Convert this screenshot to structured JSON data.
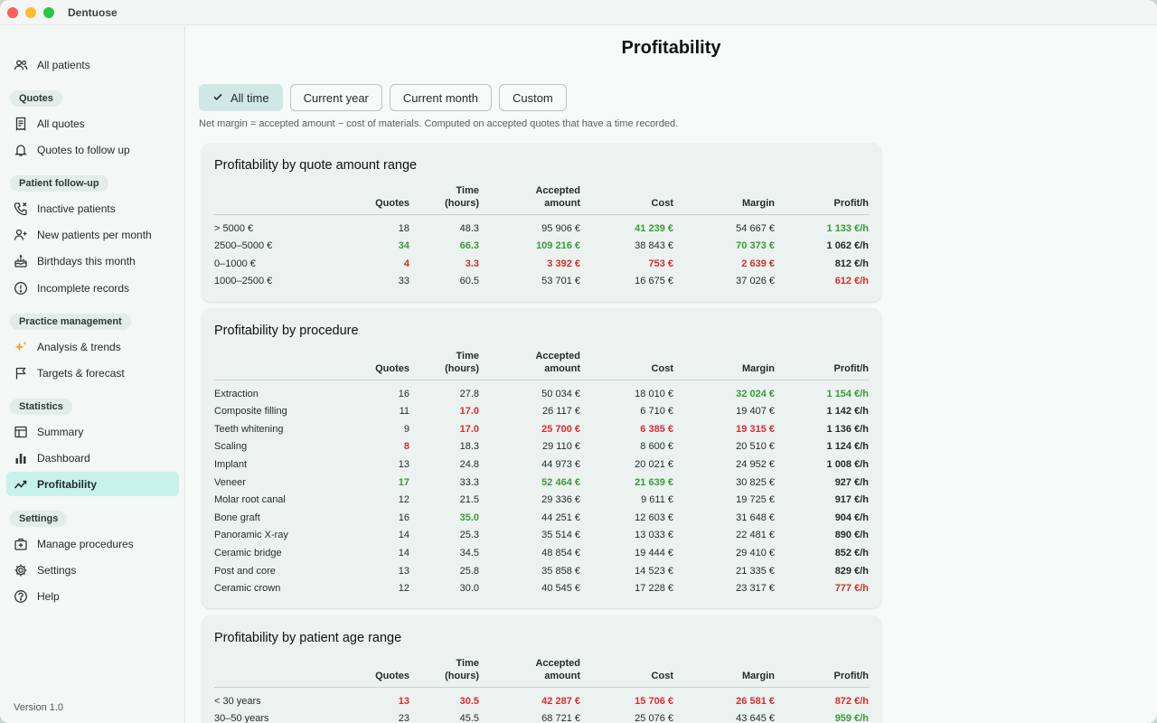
{
  "app": {
    "title": "Dentuose",
    "version": "Version 1.0"
  },
  "sidebar": {
    "top_item": {
      "label": "All patients",
      "icon": "users-icon"
    },
    "sections": [
      {
        "title": "Quotes",
        "items": [
          {
            "label": "All quotes",
            "icon": "receipt-icon"
          },
          {
            "label": "Quotes to follow up",
            "icon": "bell-icon"
          }
        ]
      },
      {
        "title": "Patient follow-up",
        "items": [
          {
            "label": "Inactive patients",
            "icon": "phone-icon"
          },
          {
            "label": "New patients per month",
            "icon": "user-plus-icon"
          },
          {
            "label": "Birthdays this month",
            "icon": "cake-icon"
          },
          {
            "label": "Incomplete records",
            "icon": "alert-circle-icon"
          }
        ]
      },
      {
        "title": "Practice management",
        "items": [
          {
            "label": "Analysis & trends",
            "icon": "sparkles-icon"
          },
          {
            "label": "Targets & forecast",
            "icon": "flag-icon"
          }
        ]
      },
      {
        "title": "Statistics",
        "items": [
          {
            "label": "Summary",
            "icon": "table-icon"
          },
          {
            "label": "Dashboard",
            "icon": "bar-chart-icon"
          },
          {
            "label": "Profitability",
            "icon": "trend-icon",
            "active": true
          }
        ]
      },
      {
        "title": "Settings",
        "items": [
          {
            "label": "Manage procedures",
            "icon": "medical-case-icon"
          },
          {
            "label": "Settings",
            "icon": "gear-icon"
          },
          {
            "label": "Help",
            "icon": "help-icon"
          }
        ]
      }
    ]
  },
  "main": {
    "title": "Profitability",
    "filters": [
      {
        "label": "All time",
        "selected": true
      },
      {
        "label": "Current year",
        "selected": false
      },
      {
        "label": "Current month",
        "selected": false
      },
      {
        "label": "Custom",
        "selected": false
      }
    ],
    "note": "Net margin = accepted amount − cost of materials. Computed on accepted quotes that have a time recorded.",
    "columns": [
      "",
      "Quotes",
      "Time\n(hours)",
      "Accepted\namount",
      "Cost",
      "Margin",
      "Profit/h"
    ],
    "tables": [
      {
        "title": "Profitability by quote amount range",
        "rows": [
          {
            "cells": [
              "> 5000 €",
              "18",
              "48.3",
              "95 906 €",
              "41 239 €",
              "54 667 €",
              "1 133 €/h"
            ],
            "hl": [
              "",
              "",
              "",
              "",
              "g",
              "",
              "g"
            ]
          },
          {
            "cells": [
              "2500–5000 €",
              "34",
              "66.3",
              "109 216 €",
              "38 843 €",
              "70 373 €",
              "1 062 €/h"
            ],
            "hl": [
              "",
              "g",
              "g",
              "g",
              "",
              "g",
              ""
            ]
          },
          {
            "cells": [
              "0–1000 €",
              "4",
              "3.3",
              "3 392 €",
              "753 €",
              "2 639 €",
              "812 €/h"
            ],
            "hl": [
              "",
              "r",
              "r",
              "r",
              "r",
              "r",
              ""
            ]
          },
          {
            "cells": [
              "1000–2500 €",
              "33",
              "60.5",
              "53 701 €",
              "16 675 €",
              "37 026 €",
              "612 €/h"
            ],
            "hl": [
              "",
              "",
              "",
              "",
              "",
              "",
              "r"
            ]
          }
        ]
      },
      {
        "title": "Profitability by procedure",
        "rows": [
          {
            "cells": [
              "Extraction",
              "16",
              "27.8",
              "50 034 €",
              "18 010 €",
              "32 024 €",
              "1 154 €/h"
            ],
            "hl": [
              "",
              "",
              "",
              "",
              "",
              "g",
              "g"
            ]
          },
          {
            "cells": [
              "Composite filling",
              "11",
              "17.0",
              "26 117 €",
              "6 710 €",
              "19 407 €",
              "1 142 €/h"
            ],
            "hl": [
              "",
              "",
              "r",
              "",
              "",
              "",
              ""
            ]
          },
          {
            "cells": [
              "Teeth whitening",
              "9",
              "17.0",
              "25 700 €",
              "6 385 €",
              "19 315 €",
              "1 136 €/h"
            ],
            "hl": [
              "",
              "",
              "r",
              "r",
              "r",
              "r",
              ""
            ]
          },
          {
            "cells": [
              "Scaling",
              "8",
              "18.3",
              "29 110 €",
              "8 600 €",
              "20 510 €",
              "1 124 €/h"
            ],
            "hl": [
              "",
              "r",
              "",
              "",
              "",
              "",
              ""
            ]
          },
          {
            "cells": [
              "Implant",
              "13",
              "24.8",
              "44 973 €",
              "20 021 €",
              "24 952 €",
              "1 008 €/h"
            ],
            "hl": [
              "",
              "",
              "",
              "",
              "",
              "",
              ""
            ]
          },
          {
            "cells": [
              "Veneer",
              "17",
              "33.3",
              "52 464 €",
              "21 639 €",
              "30 825 €",
              "927 €/h"
            ],
            "hl": [
              "",
              "g",
              "",
              "g",
              "g",
              "",
              ""
            ]
          },
          {
            "cells": [
              "Molar root canal",
              "12",
              "21.5",
              "29 336 €",
              "9 611 €",
              "19 725 €",
              "917 €/h"
            ],
            "hl": [
              "",
              "",
              "",
              "",
              "",
              "",
              ""
            ]
          },
          {
            "cells": [
              "Bone graft",
              "16",
              "35.0",
              "44 251 €",
              "12 603 €",
              "31 648 €",
              "904 €/h"
            ],
            "hl": [
              "",
              "",
              "g",
              "",
              "",
              "",
              ""
            ]
          },
          {
            "cells": [
              "Panoramic X-ray",
              "14",
              "25.3",
              "35 514 €",
              "13 033 €",
              "22 481 €",
              "890 €/h"
            ],
            "hl": [
              "",
              "",
              "",
              "",
              "",
              "",
              ""
            ]
          },
          {
            "cells": [
              "Ceramic bridge",
              "14",
              "34.5",
              "48 854 €",
              "19 444 €",
              "29 410 €",
              "852 €/h"
            ],
            "hl": [
              "",
              "",
              "",
              "",
              "",
              "",
              ""
            ]
          },
          {
            "cells": [
              "Post and core",
              "13",
              "25.8",
              "35 858 €",
              "14 523 €",
              "21 335 €",
              "829 €/h"
            ],
            "hl": [
              "",
              "",
              "",
              "",
              "",
              "",
              ""
            ]
          },
          {
            "cells": [
              "Ceramic crown",
              "12",
              "30.0",
              "40 545 €",
              "17 228 €",
              "23 317 €",
              "777 €/h"
            ],
            "hl": [
              "",
              "",
              "",
              "",
              "",
              "",
              "r"
            ]
          }
        ]
      },
      {
        "title": "Profitability by patient age range",
        "rows": [
          {
            "cells": [
              "< 30 years",
              "13",
              "30.5",
              "42 287 €",
              "15 706 €",
              "26 581 €",
              "872 €/h"
            ],
            "hl": [
              "",
              "r",
              "r",
              "r",
              "r",
              "r",
              "r"
            ]
          },
          {
            "cells": [
              "30–50 years",
              "23",
              "45.5",
              "68 721 €",
              "25 076 €",
              "43 645 €",
              "959 €/h"
            ],
            "hl": [
              "",
              "",
              "",
              "",
              "",
              "",
              "g"
            ]
          }
        ]
      }
    ]
  },
  "colors": {
    "accent": "#c7f2ea",
    "good": "#3a9a3a",
    "bad": "#d32f2f"
  }
}
